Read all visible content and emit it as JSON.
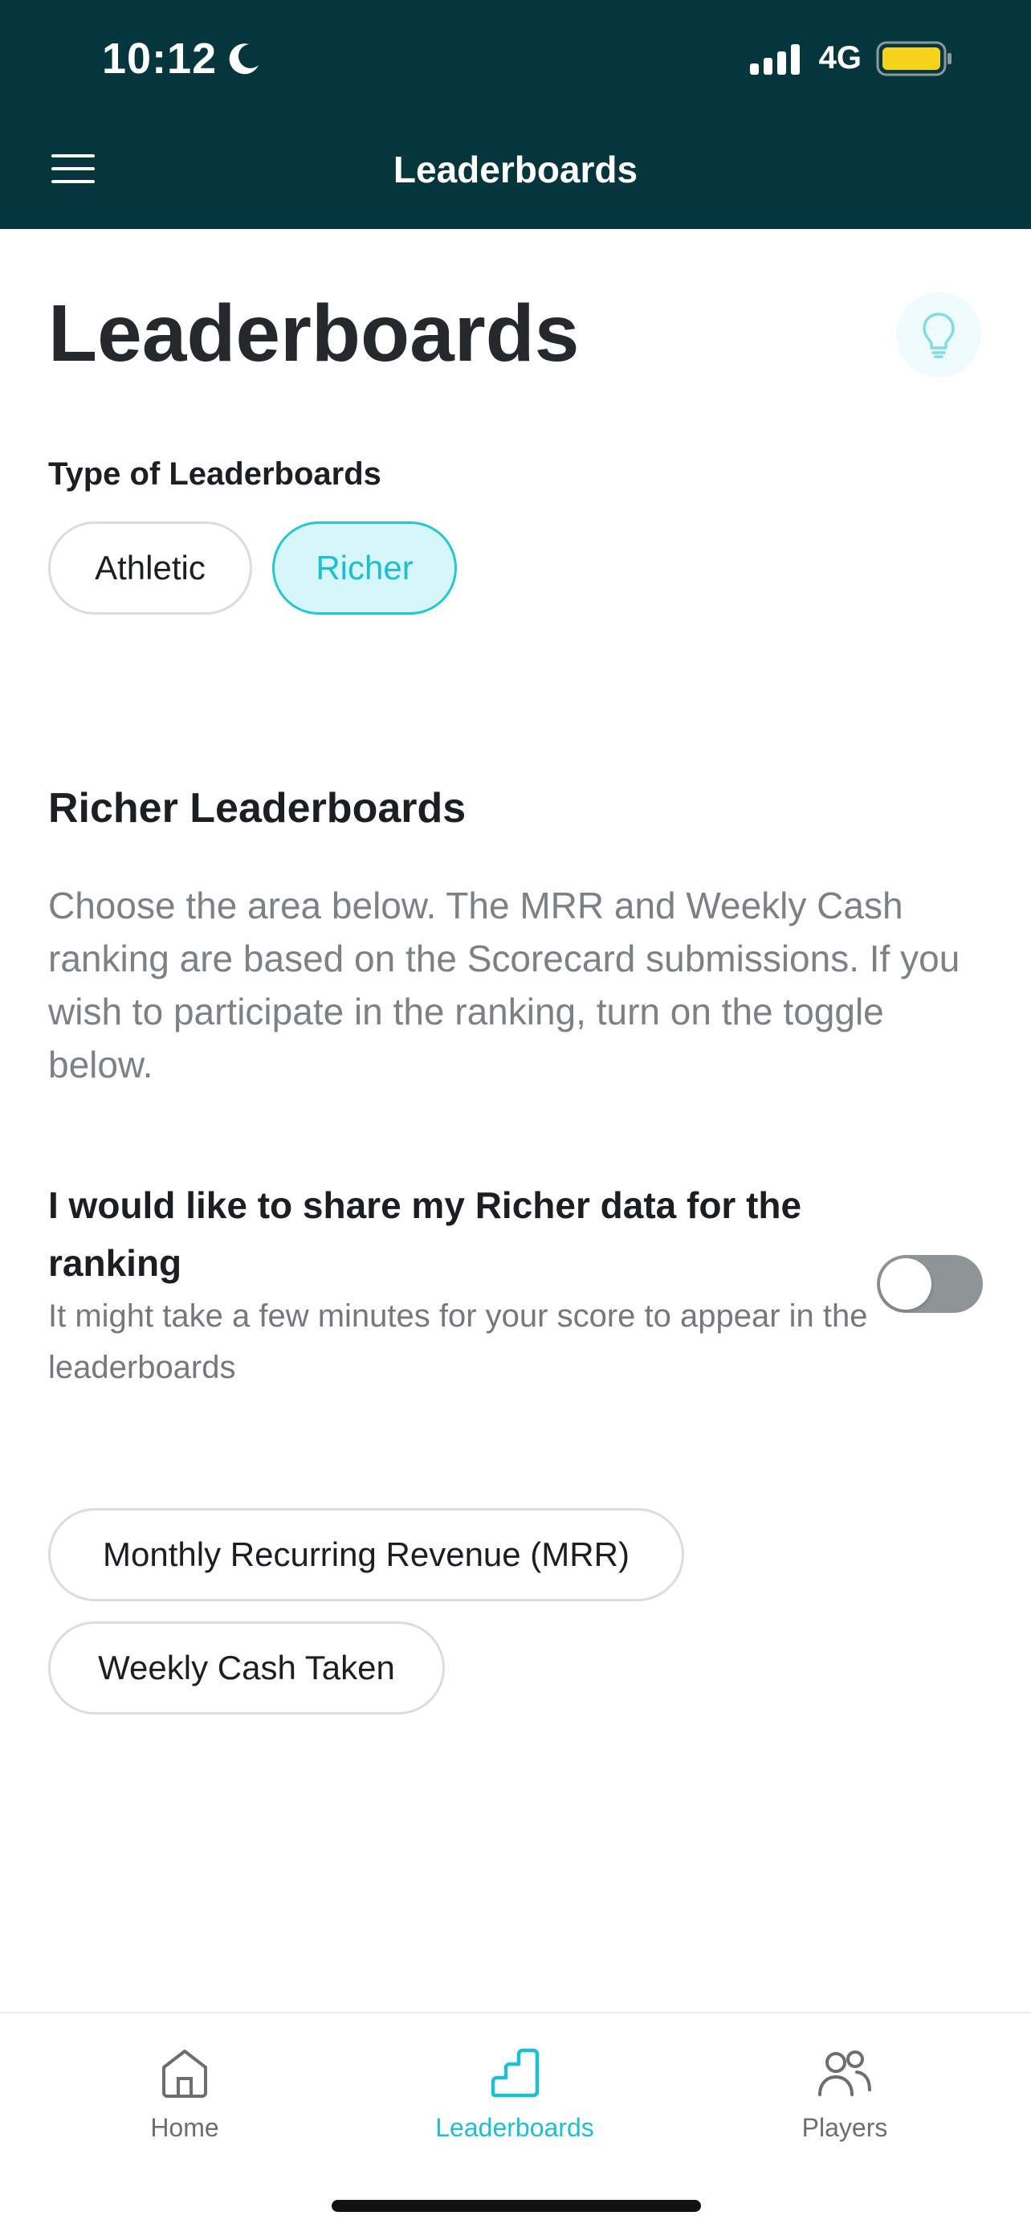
{
  "status_bar": {
    "time": "10:12",
    "network": "4G",
    "battery_color": "#f6d21b"
  },
  "header": {
    "title": "Leaderboards",
    "menu_icon": "hamburger-icon",
    "background": "#05363d"
  },
  "page": {
    "title": "Leaderboards",
    "tip_icon": "lightbulb-icon"
  },
  "type_selector": {
    "label": "Type of Leaderboards",
    "options": [
      "Athletic",
      "Richer"
    ],
    "selected": "Richer"
  },
  "richer_section": {
    "title": "Richer Leaderboards",
    "description": "Choose the area below. The MRR and Weekly Cash ranking are based on the Scorecard submissions. If you wish to participate in the ranking, turn on the toggle below.",
    "share_title": "I would like to share my Richer data for the ranking",
    "share_subtitle": "It might take a few minutes for your score to appear in the leaderboards",
    "share_enabled": false
  },
  "areas": {
    "items": [
      "Monthly Recurring Revenue (MRR)",
      "Weekly Cash Taken"
    ]
  },
  "tabbar": {
    "items": [
      {
        "label": "Home",
        "icon": "home-icon"
      },
      {
        "label": "Leaderboards",
        "icon": "leaderboards-stairs-icon"
      },
      {
        "label": "Players",
        "icon": "players-icon"
      }
    ],
    "active": "Leaderboards"
  },
  "colors": {
    "accent": "#1cbfd3",
    "accent_bg": "#d6f6fa",
    "header_bg": "#05363d"
  }
}
